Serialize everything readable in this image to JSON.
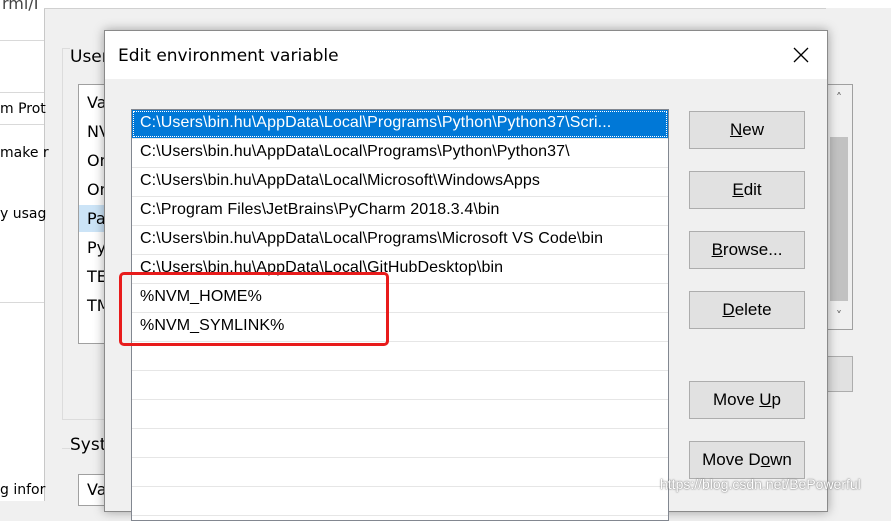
{
  "background": {
    "left_fragments": [
      "rml/I",
      "m Prot",
      "make r",
      "y usag",
      "g infor"
    ],
    "user_group_label": "User",
    "system_group_label": "Syste",
    "user_vars_partial": [
      "Va",
      "NV",
      "On",
      "On",
      "Pa",
      "Py",
      "TE",
      "TM"
    ],
    "system_vars_partial": [
      "Va"
    ]
  },
  "dialog": {
    "title": "Edit environment variable",
    "paths": [
      "C:\\Users\\bin.hu\\AppData\\Local\\Programs\\Python\\Python37\\Scri...",
      "C:\\Users\\bin.hu\\AppData\\Local\\Programs\\Python\\Python37\\",
      "C:\\Users\\bin.hu\\AppData\\Local\\Microsoft\\WindowsApps",
      "C:\\Program Files\\JetBrains\\PyCharm 2018.3.4\\bin",
      "C:\\Users\\bin.hu\\AppData\\Local\\Programs\\Microsoft VS Code\\bin",
      "C:\\Users\\bin.hu\\AppData\\Local\\GitHubDesktop\\bin",
      "%NVM_HOME%",
      "%NVM_SYMLINK%"
    ],
    "buttons": {
      "new": {
        "pre": "",
        "key": "N",
        "post": "ew"
      },
      "edit": {
        "pre": "",
        "key": "E",
        "post": "dit"
      },
      "browse": {
        "pre": "",
        "key": "B",
        "post": "rowse..."
      },
      "delete": {
        "pre": "",
        "key": "D",
        "post": "elete"
      },
      "move_up": {
        "pre": "Move ",
        "key": "U",
        "post": "p"
      },
      "move_down": {
        "pre": "Move D",
        "key": "o",
        "post": "wn"
      }
    }
  },
  "watermark": "https://blog.csdn.net/BePowerful",
  "colors": {
    "selection": "#0078d7",
    "highlight_box": "#e81b1b",
    "bg_selection": "#cce4f7"
  }
}
